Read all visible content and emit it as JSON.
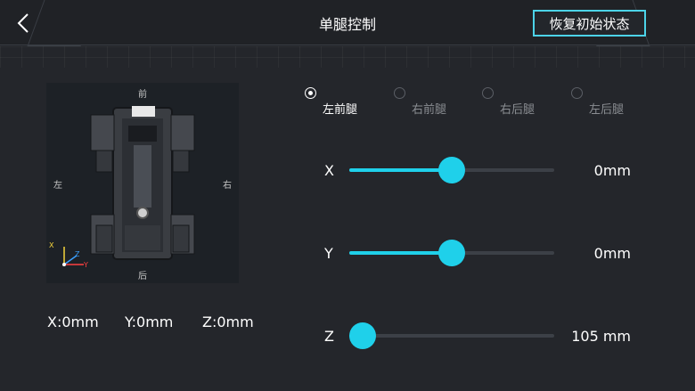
{
  "header": {
    "title": "单腿控制",
    "reset_label": "恢复初始状态"
  },
  "robot": {
    "directions": {
      "front": "前",
      "back": "后",
      "left": "左",
      "right": "右"
    },
    "axes": {
      "x": "X",
      "y": "Y",
      "z": "Z"
    },
    "colors": {
      "x_axis": "#f5d43c",
      "y_axis": "#ff4040",
      "z_axis": "#3aa0ff"
    }
  },
  "coords": {
    "x": "X:0mm",
    "y": "Y:0mm",
    "z": "Z:0mm"
  },
  "legs": [
    {
      "label": "左前腿",
      "selected": true
    },
    {
      "label": "右前腿",
      "selected": false
    },
    {
      "label": "右后腿",
      "selected": false
    },
    {
      "label": "左后腿",
      "selected": false
    }
  ],
  "sliders": [
    {
      "axis": "X",
      "value_text": "0mm",
      "fraction": 0.5
    },
    {
      "axis": "Y",
      "value_text": "0mm",
      "fraction": 0.5
    },
    {
      "axis": "Z",
      "value_text": "105 mm",
      "fraction": 0.06
    }
  ],
  "colors": {
    "accent": "#1fd0ea",
    "background": "#24262b",
    "button_border": "#4cd3e8"
  }
}
